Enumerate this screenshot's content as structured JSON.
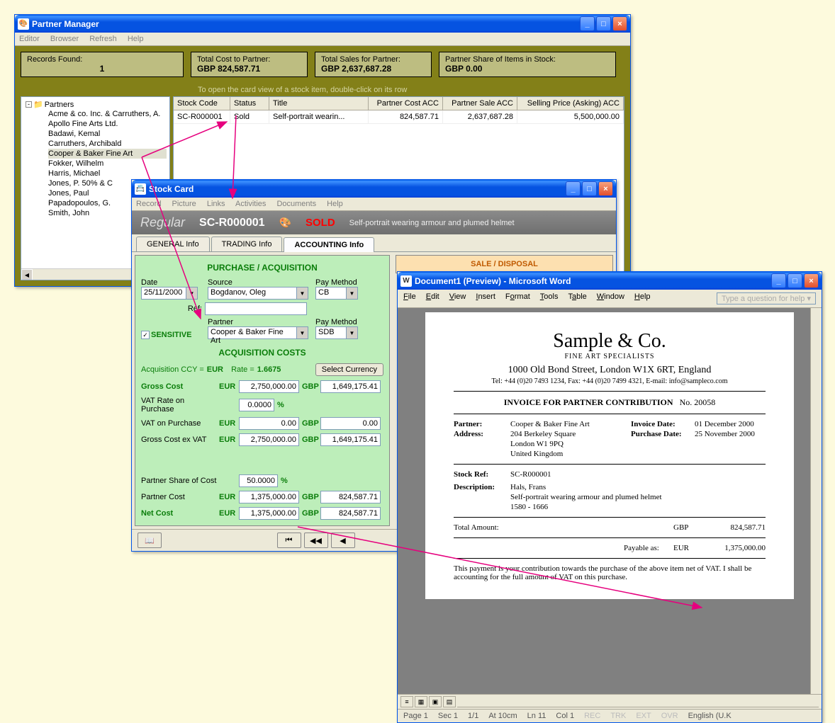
{
  "pm": {
    "title": "Partner Manager",
    "menus": [
      "Editor",
      "Browser",
      "Refresh",
      "Help"
    ],
    "records_label": "Records Found:",
    "records_val": "1",
    "total_cost_label": "Total Cost to Partner:",
    "total_cost_val": "GBP  824,587.71",
    "total_sales_label": "Total Sales for Partner:",
    "total_sales_val": "GBP  2,637,687.28",
    "share_label": "Partner Share of Items in Stock:",
    "share_val": "GBP  0.00",
    "helper": "To open the card view of a stock item, double-click on its row",
    "tree_root": "Partners",
    "tree_items": [
      "Acme & co. Inc. & Carruthers, A.",
      "Apollo Fine Arts Ltd.",
      "Badawi, Kemal",
      "Carruthers, Archibald",
      "Cooper & Baker Fine Art",
      "Fokker, Wilhelm",
      "Harris, Michael",
      "Jones, P. 50% & C",
      "Jones, Paul",
      "Papadopoulos, G.",
      "Smith, John"
    ],
    "tree_selected": 4,
    "grid_headers": [
      "Stock Code",
      "Status",
      "Title",
      "Partner Cost ACC",
      "Partner Sale ACC",
      "Selling Price (Asking) ACC"
    ],
    "grid_row": [
      "SC-R000001",
      "Sold",
      "Self-portrait wearin...",
      "824,587.71",
      "2,637,687.28",
      "5,500,000.00"
    ]
  },
  "sc": {
    "title": "Stock Card",
    "menus": [
      "Record",
      "Picture",
      "Links",
      "Activities",
      "Documents",
      "Help"
    ],
    "type": "Regular",
    "code": "SC-R000001",
    "status": "SOLD",
    "desc": "Self-portrait wearing armour and plumed helmet",
    "tabs": [
      "GENERAL Info",
      "TRADING Info",
      "ACCOUNTING Info"
    ],
    "active_tab": 2,
    "purchase_title": "PURCHASE / ACQUISITION",
    "sale_title": "SALE / DISPOSAL",
    "date_lbl": "Date",
    "date_val": "25/11/2000",
    "source_lbl": "Source",
    "source_val": "Bogdanov, Oleg",
    "paymethod_lbl": "Pay Method",
    "paymethod1": "CB",
    "paymethod2": "SDB",
    "ref_lbl": "Ref:",
    "ref_val": "",
    "sensitive_lbl": "SENSITIVE",
    "partner_lbl": "Partner",
    "partner_val": "Cooper & Baker Fine Art",
    "acq_title": "ACQUISITION COSTS",
    "acq_ccy_pre": "Acquisition CCY =",
    "acq_ccy_ccy": "EUR",
    "acq_ccy_rate_lbl": "Rate =",
    "acq_ccy_rate": "1.6675",
    "select_ccy_btn": "Select Currency",
    "eur": "EUR",
    "gbp": "GBP",
    "pct": "%",
    "gross_cost_lbl": "Gross Cost",
    "gross_cost_eur": "2,750,000.00",
    "gross_cost_gbp": "1,649,175.41",
    "vat_rate_lbl": "VAT Rate on Purchase",
    "vat_rate": "0.0000",
    "vat_on_lbl": "VAT on Purchase",
    "vat_on_eur": "0.00",
    "vat_on_gbp": "0.00",
    "gross_ex_lbl": "Gross Cost ex VAT",
    "gross_ex_eur": "2,750,000.00",
    "gross_ex_gbp": "1,649,175.41",
    "pshare_lbl": "Partner Share of Cost",
    "pshare_val": "50.0000",
    "pcost_lbl": "Partner Cost",
    "pcost_eur": "1,375,000.00",
    "pcost_gbp": "824,587.71",
    "net_lbl": "Net Cost",
    "net_eur": "1,375,000.00",
    "net_gbp": "824,587.71",
    "nav_book": "📖",
    "nav_first": "⏮",
    "nav_prevpg": "◀◀",
    "nav_prev": "◀"
  },
  "word": {
    "title": "Document1 (Preview)  - Microsoft Word",
    "menus": [
      "File",
      "Edit",
      "View",
      "Insert",
      "Format",
      "Tools",
      "Table",
      "Window",
      "Help"
    ],
    "ask": "Type a question for help",
    "company": "Sample & Co.",
    "subtitle": "FINE ART SPECIALISTS",
    "address": "1000 Old Bond Street, London W1X 6RT, England",
    "contact": "Tel: +44 (0)20 7493 1234,   Fax: +44 (0)20 7499 4321,  E-mail: info@sampleco.com",
    "inv_title": "INVOICE FOR PARTNER CONTRIBUTION",
    "inv_no_lbl": "No.",
    "inv_no": "20058",
    "partner_lbl": "Partner:",
    "partner_val": "Cooper & Baker Fine Art",
    "invdate_lbl": "Invoice Date:",
    "invdate_val": "01 December 2000",
    "address_lbl": "Address:",
    "address_l1": "204 Berkeley Square",
    "address_l2": "London W1 9PQ",
    "address_l3": "United Kingdom",
    "purdate_lbl": "Purchase Date:",
    "purdate_val": "25 November 2000",
    "stockref_lbl": "Stock Ref:",
    "stockref_val": "SC-R000001",
    "desc_lbl": "Description:",
    "desc_l1": "Hals, Frans",
    "desc_l2": "Self-portrait wearing armour and plumed helmet",
    "desc_l3": "1580 - 1666",
    "total_lbl": "Total Amount:",
    "total_ccy": "GBP",
    "total_val": "824,587.71",
    "payable_lbl": "Payable as:",
    "payable_ccy": "EUR",
    "payable_val": "1,375,000.00",
    "note": "This payment is your contribution towards the purchase of the above item net of VAT.  I shall be accounting for the full amount of VAT on this purchase.",
    "status": {
      "page": "Page  1",
      "sec": "Sec 1",
      "pages": "1/1",
      "at": "At  10cm",
      "ln": "Ln  11",
      "col": "Col  1",
      "rec": "REC",
      "trk": "TRK",
      "ext": "EXT",
      "ovr": "OVR",
      "lang": "English (U.K"
    }
  }
}
